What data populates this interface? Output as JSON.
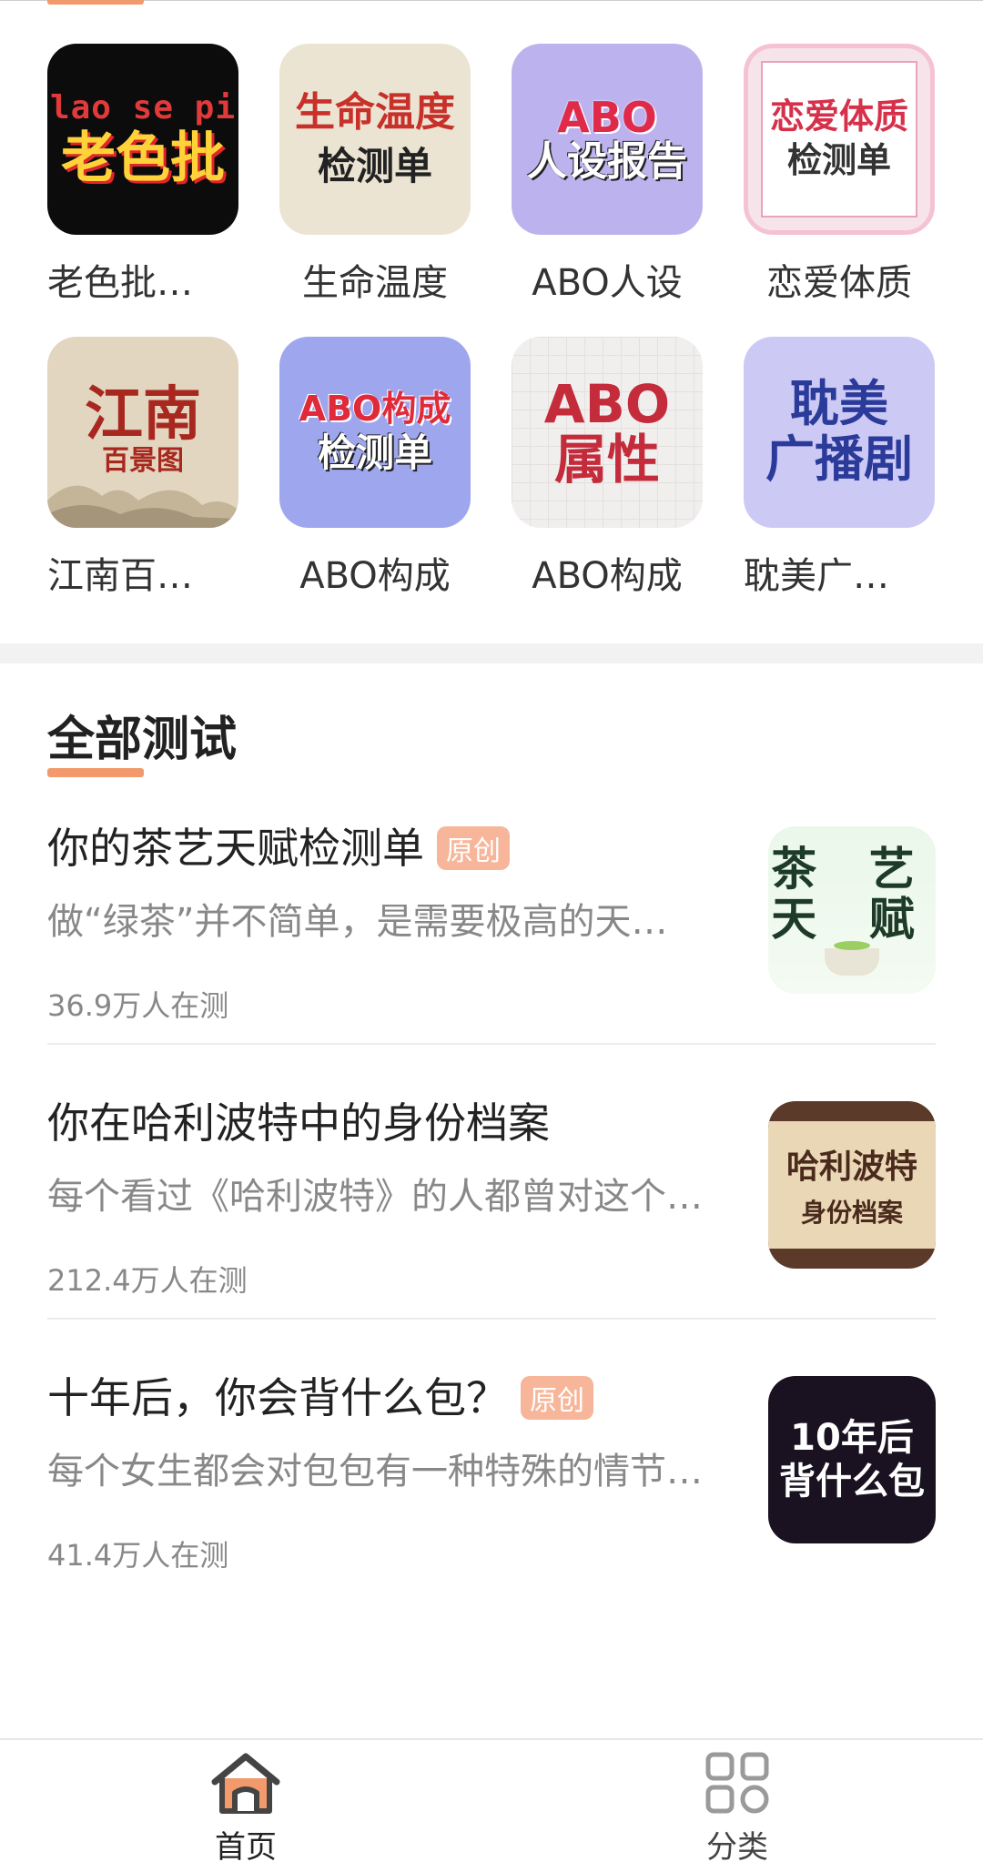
{
  "grid": {
    "items": [
      {
        "label": "老色批…",
        "line1": "lao se pi",
        "line2": "老色批"
      },
      {
        "label": "生命温度",
        "line1": "生命温度",
        "line2": "检测单"
      },
      {
        "label": "ABO人设",
        "line1": "ABO",
        "line2": "人设报告"
      },
      {
        "label": "恋爱体质",
        "line1": "恋爱体质",
        "line2": "检测单"
      },
      {
        "label": "江南百…",
        "line1": "江南",
        "line2": "百景图"
      },
      {
        "label": "ABO构成",
        "line1": "ABO构成",
        "line2": "检测单"
      },
      {
        "label": "ABO构成",
        "line1": "ABO",
        "line2": "属性"
      },
      {
        "label": "耽美广…",
        "line1": "耽美",
        "line2": "广播剧"
      }
    ]
  },
  "section": {
    "title": "全部测试"
  },
  "tests": [
    {
      "title": "你的茶艺天赋检测单",
      "badge": "原创",
      "desc": "做“绿茶”并不简单，是需要极高的天…",
      "count": "36.9万人在测",
      "thumb_line1": "茶 艺",
      "thumb_line2": "天 赋"
    },
    {
      "title": "你在哈利波特中的身份档案",
      "badge": "",
      "desc": "每个看过《哈利波特》的人都曾对这个…",
      "count": "212.4万人在测",
      "thumb_line1": "哈利波特",
      "thumb_line2": "身份档案"
    },
    {
      "title": "十年后，你会背什么包？",
      "badge": "原创",
      "desc": "每个女生都会对包包有一种特殊的情节…",
      "count": "41.4万人在测",
      "thumb_line1": "10年后",
      "thumb_line2": "背什么包"
    }
  ],
  "nav": {
    "home_label": "首页",
    "category_label": "分类"
  },
  "colors": {
    "accent": "#f29a6b",
    "badge_bg": "#f7b69a"
  }
}
